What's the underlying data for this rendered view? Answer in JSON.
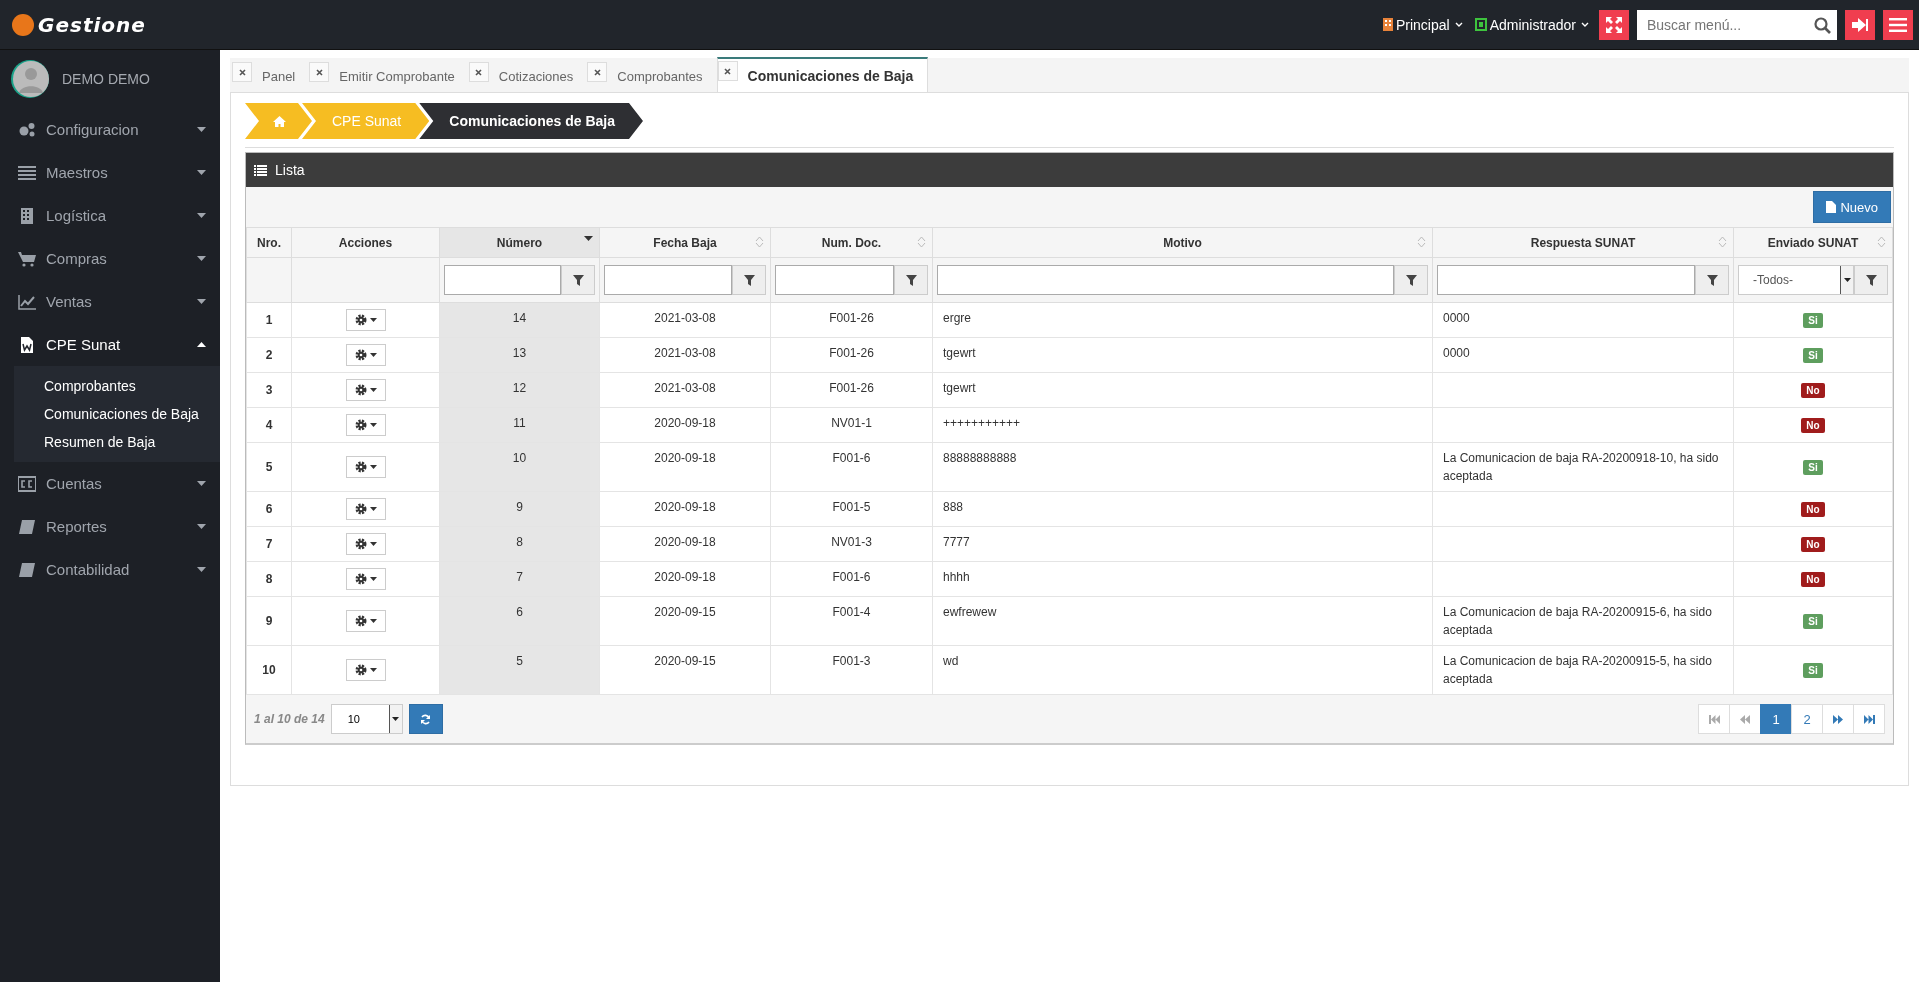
{
  "header": {
    "logo": "Gestione",
    "branch": "Principal",
    "user_role": "Administrador",
    "search": {
      "placeholder": "Buscar menú..."
    }
  },
  "sidebar": {
    "user": "DEMO DEMO",
    "items": [
      {
        "label": "Configuracion",
        "expanded": false
      },
      {
        "label": "Maestros",
        "expanded": false
      },
      {
        "label": "Logística",
        "expanded": false
      },
      {
        "label": "Compras",
        "expanded": false
      },
      {
        "label": "Ventas",
        "expanded": false
      },
      {
        "label": "CPE Sunat",
        "expanded": true,
        "children": [
          {
            "label": "Comprobantes"
          },
          {
            "label": "Comunicaciones de Baja"
          },
          {
            "label": "Resumen de Baja"
          }
        ]
      },
      {
        "label": "Cuentas",
        "expanded": false
      },
      {
        "label": "Reportes",
        "expanded": false
      },
      {
        "label": "Contabilidad",
        "expanded": false
      }
    ]
  },
  "tabs": [
    {
      "label": "Panel",
      "selected": false
    },
    {
      "label": "Emitir Comprobante",
      "selected": false
    },
    {
      "label": "Cotizaciones",
      "selected": false
    },
    {
      "label": "Comprobantes",
      "selected": false
    },
    {
      "label": "Comunicaciones de Baja",
      "selected": true
    }
  ],
  "breadcrumb": [
    "CPE Sunat",
    "Comunicaciones de Baja"
  ],
  "panel": {
    "title": "Lista",
    "new_button": "Nuevo"
  },
  "table": {
    "columns": [
      {
        "label": "Nro.",
        "sortable": false,
        "sorted": false,
        "kind": "plain"
      },
      {
        "label": "Acciones",
        "sortable": false,
        "sorted": false,
        "kind": "plain"
      },
      {
        "label": "Número",
        "sortable": true,
        "sorted": true,
        "kind": "text"
      },
      {
        "label": "Fecha Baja",
        "sortable": true,
        "sorted": false,
        "kind": "text"
      },
      {
        "label": "Num. Doc.",
        "sortable": true,
        "sorted": false,
        "kind": "text"
      },
      {
        "label": "Motivo",
        "sortable": true,
        "sorted": false,
        "kind": "text"
      },
      {
        "label": "Respuesta SUNAT",
        "sortable": true,
        "sorted": false,
        "kind": "text"
      },
      {
        "label": "Enviado SUNAT",
        "sortable": true,
        "sorted": false,
        "kind": "select",
        "value": "-Todos-"
      }
    ],
    "rows": [
      {
        "nro": "1",
        "numero": "14",
        "fecha": "2021-03-08",
        "doc": "F001-26",
        "motivo": "ergre",
        "respuesta": "0000",
        "enviado": "Si",
        "sent": true
      },
      {
        "nro": "2",
        "numero": "13",
        "fecha": "2021-03-08",
        "doc": "F001-26",
        "motivo": "tgewrt",
        "respuesta": "0000",
        "enviado": "Si",
        "sent": true
      },
      {
        "nro": "3",
        "numero": "12",
        "fecha": "2021-03-08",
        "doc": "F001-26",
        "motivo": "tgewrt",
        "enviado": "No",
        "sent": false
      },
      {
        "nro": "4",
        "numero": "11",
        "fecha": "2020-09-18",
        "doc": "NV01-1",
        "motivo": "+++++++++++",
        "enviado": "No",
        "sent": false
      },
      {
        "nro": "5",
        "numero": "10",
        "fecha": "2020-09-18",
        "doc": "F001-6",
        "motivo": "88888888888",
        "respuesta": "La Comunicacion de baja RA-20200918-10, ha sido aceptada",
        "enviado": "Si",
        "sent": true
      },
      {
        "nro": "6",
        "numero": "9",
        "fecha": "2020-09-18",
        "doc": "F001-5",
        "motivo": "888",
        "enviado": "No",
        "sent": false
      },
      {
        "nro": "7",
        "numero": "8",
        "fecha": "2020-09-18",
        "doc": "NV01-3",
        "motivo": "7777",
        "enviado": "No",
        "sent": false
      },
      {
        "nro": "8",
        "numero": "7",
        "fecha": "2020-09-18",
        "doc": "F001-6",
        "motivo": "hhhh",
        "enviado": "No",
        "sent": false
      },
      {
        "nro": "9",
        "numero": "6",
        "fecha": "2020-09-15",
        "doc": "F001-4",
        "motivo": "ewfrewew",
        "respuesta": "La Comunicacion de baja RA-20200915-6, ha sido aceptada",
        "enviado": "Si",
        "sent": true
      },
      {
        "nro": "10",
        "numero": "5",
        "fecha": "2020-09-15",
        "doc": "F001-3",
        "motivo": "wd",
        "respuesta": "La Comunicacion de baja RA-20200915-5, ha sido aceptada",
        "enviado": "Si",
        "sent": true
      }
    ]
  },
  "footer": {
    "range": "1 al 10 de 14",
    "page_size": "10",
    "pages": [
      {
        "label": "1",
        "selected": true
      },
      {
        "label": "2",
        "selected": false
      }
    ]
  }
}
